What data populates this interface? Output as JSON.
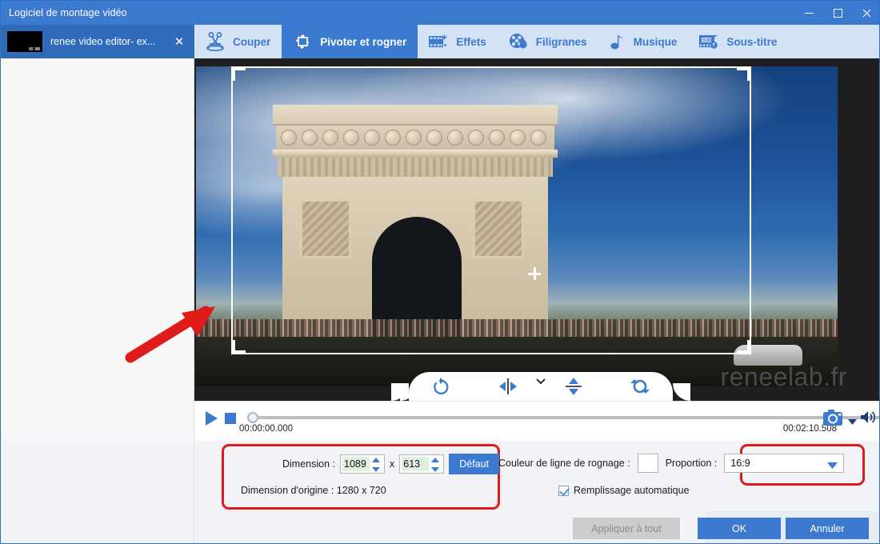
{
  "window": {
    "title": "Logiciel de montage vidéo",
    "controls": {
      "minimize": "minimize-icon",
      "maximize": "maximize-icon",
      "close": "close-icon"
    }
  },
  "file_tab": {
    "name": "renee video editor- ex...",
    "close_label": "✕"
  },
  "toolbar": {
    "items": [
      {
        "label": "Couper",
        "icon": "scissors-icon",
        "active": false
      },
      {
        "label": "Pivoter et rogner",
        "icon": "crop-rotate-icon",
        "active": true
      },
      {
        "label": "Effets",
        "icon": "film-effects-icon",
        "active": false
      },
      {
        "label": "Filigranes",
        "icon": "watermark-icon",
        "active": false
      },
      {
        "label": "Musique",
        "icon": "music-note-icon",
        "active": false
      },
      {
        "label": "Sous-titre",
        "icon": "subtitle-icon",
        "active": false
      }
    ]
  },
  "preview": {
    "watermark": "reneelab.fr",
    "rotate_tools": [
      {
        "name": "rotate-right-icon"
      },
      {
        "name": "flip-horizontal-icon"
      },
      {
        "name": "flip-vertical-icon"
      },
      {
        "name": "rotate-reset-icon"
      }
    ],
    "collapse_icon": "chevron-down-icon"
  },
  "player": {
    "play_icon": "play-icon",
    "stop_icon": "stop-icon",
    "current_time": "00:00:00.000",
    "total_time": "00:02:10.508",
    "snapshot_icon": "camera-icon",
    "volume_icon": "volume-icon",
    "volume_caret_icon": "caret-down-icon",
    "progress_percent": 0
  },
  "options": {
    "dimension_label": "Dimension :",
    "width_value": "1089",
    "height_value": "613",
    "x_separator": "x",
    "default_button": "Défaut",
    "origin_label": "Dimension d'origine : 1280 x 720",
    "crop_color_label": "Couleur de ligne de rognage :",
    "crop_color_value": "#ffffff",
    "proportion_label": "Proportion :",
    "proportion_value": "16:9",
    "autofill_label": "Remplissage automatique",
    "autofill_checked": true
  },
  "footer": {
    "apply_all": "Appliquer à tout",
    "ok": "OK",
    "cancel": "Annuler"
  },
  "colors": {
    "accent": "#3c7ad0",
    "titlebar": "#3c7ad0",
    "toolbar_bg": "#d3e2f5",
    "annotation_red": "#e01b1b",
    "input_bg": "#dff0dd"
  }
}
